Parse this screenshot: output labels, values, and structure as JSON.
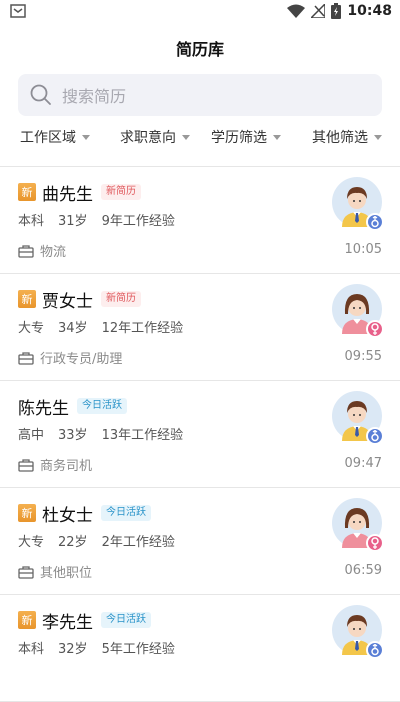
{
  "status_bar": {
    "time": "10:48"
  },
  "header": {
    "title": "简历库"
  },
  "search": {
    "placeholder": "搜索简历"
  },
  "filters": [
    {
      "label": "工作区域"
    },
    {
      "label": "求职意向"
    },
    {
      "label": "学历筛选"
    },
    {
      "label": "其他筛选"
    }
  ],
  "resumes": [
    {
      "is_new": true,
      "new_label": "新",
      "name": "曲先生",
      "tag": "新简历",
      "tag_style": "red",
      "education": "本科",
      "age": "31岁",
      "experience": "9年工作经验",
      "position": "物流",
      "time": "10:05",
      "gender": "male"
    },
    {
      "is_new": true,
      "new_label": "新",
      "name": "贾女士",
      "tag": "新简历",
      "tag_style": "red",
      "education": "大专",
      "age": "34岁",
      "experience": "12年工作经验",
      "position": "行政专员/助理",
      "time": "09:55",
      "gender": "female"
    },
    {
      "is_new": false,
      "new_label": "",
      "name": "陈先生",
      "tag": "今日活跃",
      "tag_style": "blue",
      "education": "高中",
      "age": "33岁",
      "experience": "13年工作经验",
      "position": "商务司机",
      "time": "09:47",
      "gender": "male"
    },
    {
      "is_new": true,
      "new_label": "新",
      "name": "杜女士",
      "tag": "今日活跃",
      "tag_style": "blue",
      "education": "大专",
      "age": "22岁",
      "experience": "2年工作经验",
      "position": "其他职位",
      "time": "06:59",
      "gender": "female"
    },
    {
      "is_new": true,
      "new_label": "新",
      "name": "李先生",
      "tag": "今日活跃",
      "tag_style": "blue",
      "education": "本科",
      "age": "32岁",
      "experience": "5年工作经验",
      "position": "",
      "time": "",
      "gender": "male"
    }
  ],
  "colors": {
    "accent_orange": "#e8952c",
    "male": "#5a7fd6",
    "female": "#e8608a"
  }
}
